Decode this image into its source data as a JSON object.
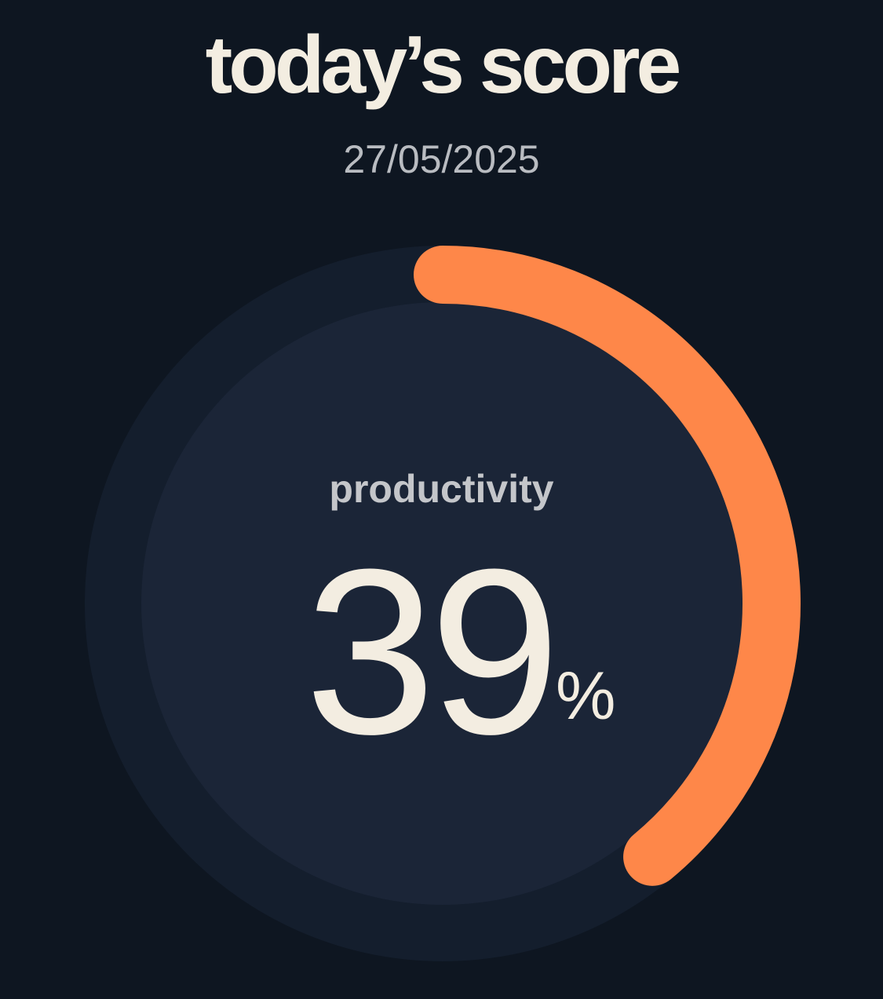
{
  "header": {
    "title": "today’s score",
    "date": "27/05/2025"
  },
  "gauge": {
    "label": "productivity",
    "value": "39",
    "unit": "%",
    "progress_percent": 39,
    "colors": {
      "background": "#0e1621",
      "outer_ring": "#141e2d",
      "inner_disc": "#1b2537",
      "progress_arc": "#fe8749",
      "text_primary": "#f3ede1",
      "text_secondary": "#b9bcc1"
    }
  }
}
